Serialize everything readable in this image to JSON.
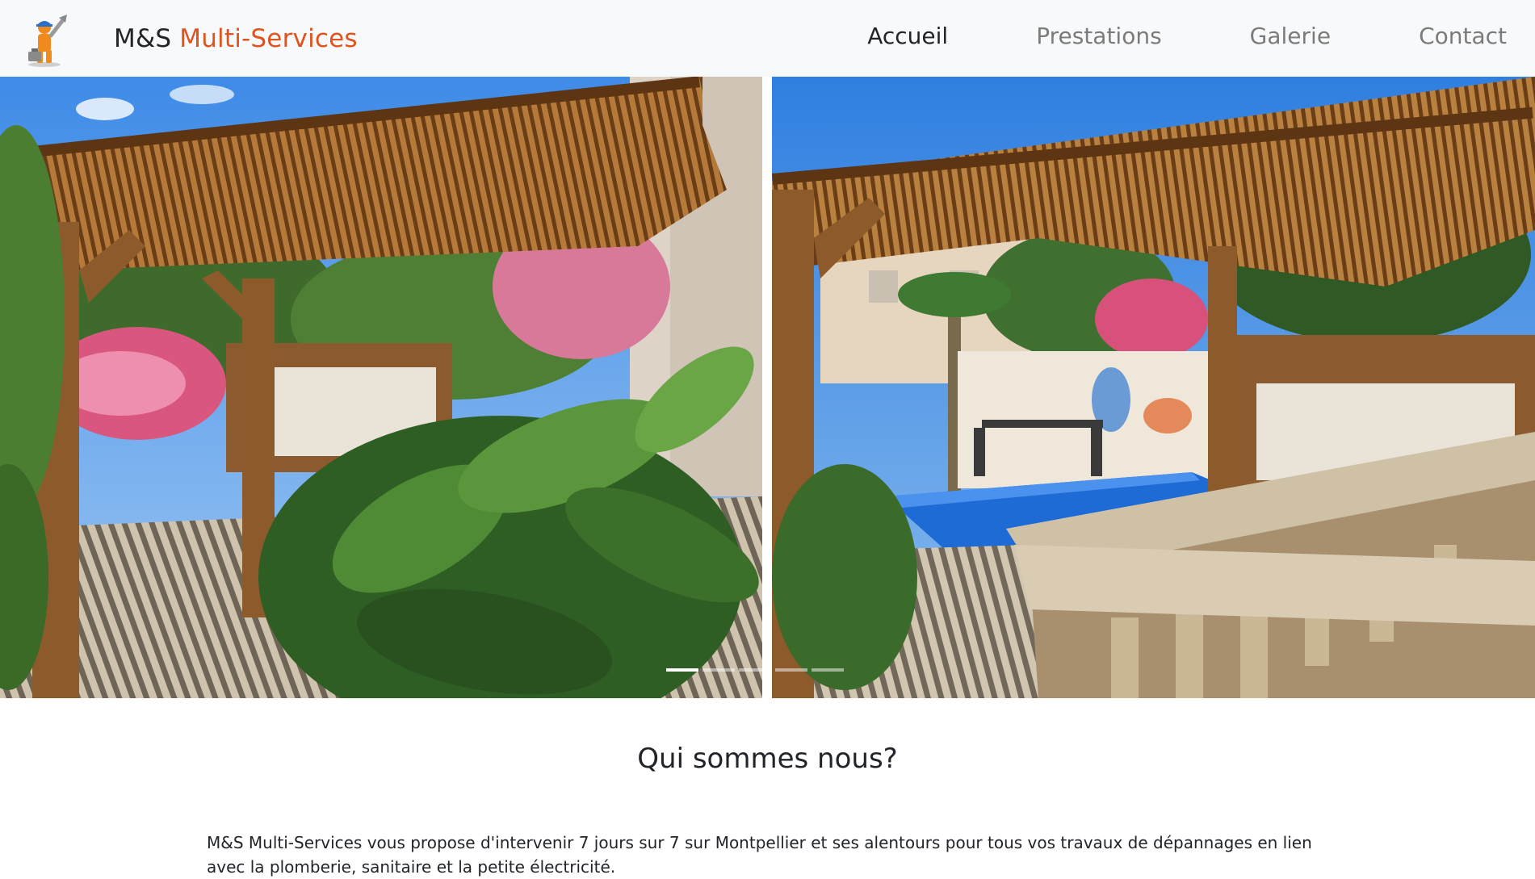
{
  "brand": {
    "name_part1": "M&S ",
    "name_part2": "Multi-Services",
    "logo_icon": "handyman-icon",
    "accent_color": "#e0531c"
  },
  "nav": {
    "items": [
      {
        "label": "Accueil",
        "active": true
      },
      {
        "label": "Prestations",
        "active": false
      },
      {
        "label": "Galerie",
        "active": false
      },
      {
        "label": "Contact",
        "active": false
      }
    ]
  },
  "carousel": {
    "slide_count": 5,
    "active_index": 0
  },
  "about": {
    "title": "Qui sommes nous?",
    "text": "M&S Multi-Services vous propose d'intervenir 7 jours sur 7 sur Montpellier et ses alentours pour tous vos travaux de dépannages en lien avec la plomberie, sanitaire et la petite électricité."
  }
}
